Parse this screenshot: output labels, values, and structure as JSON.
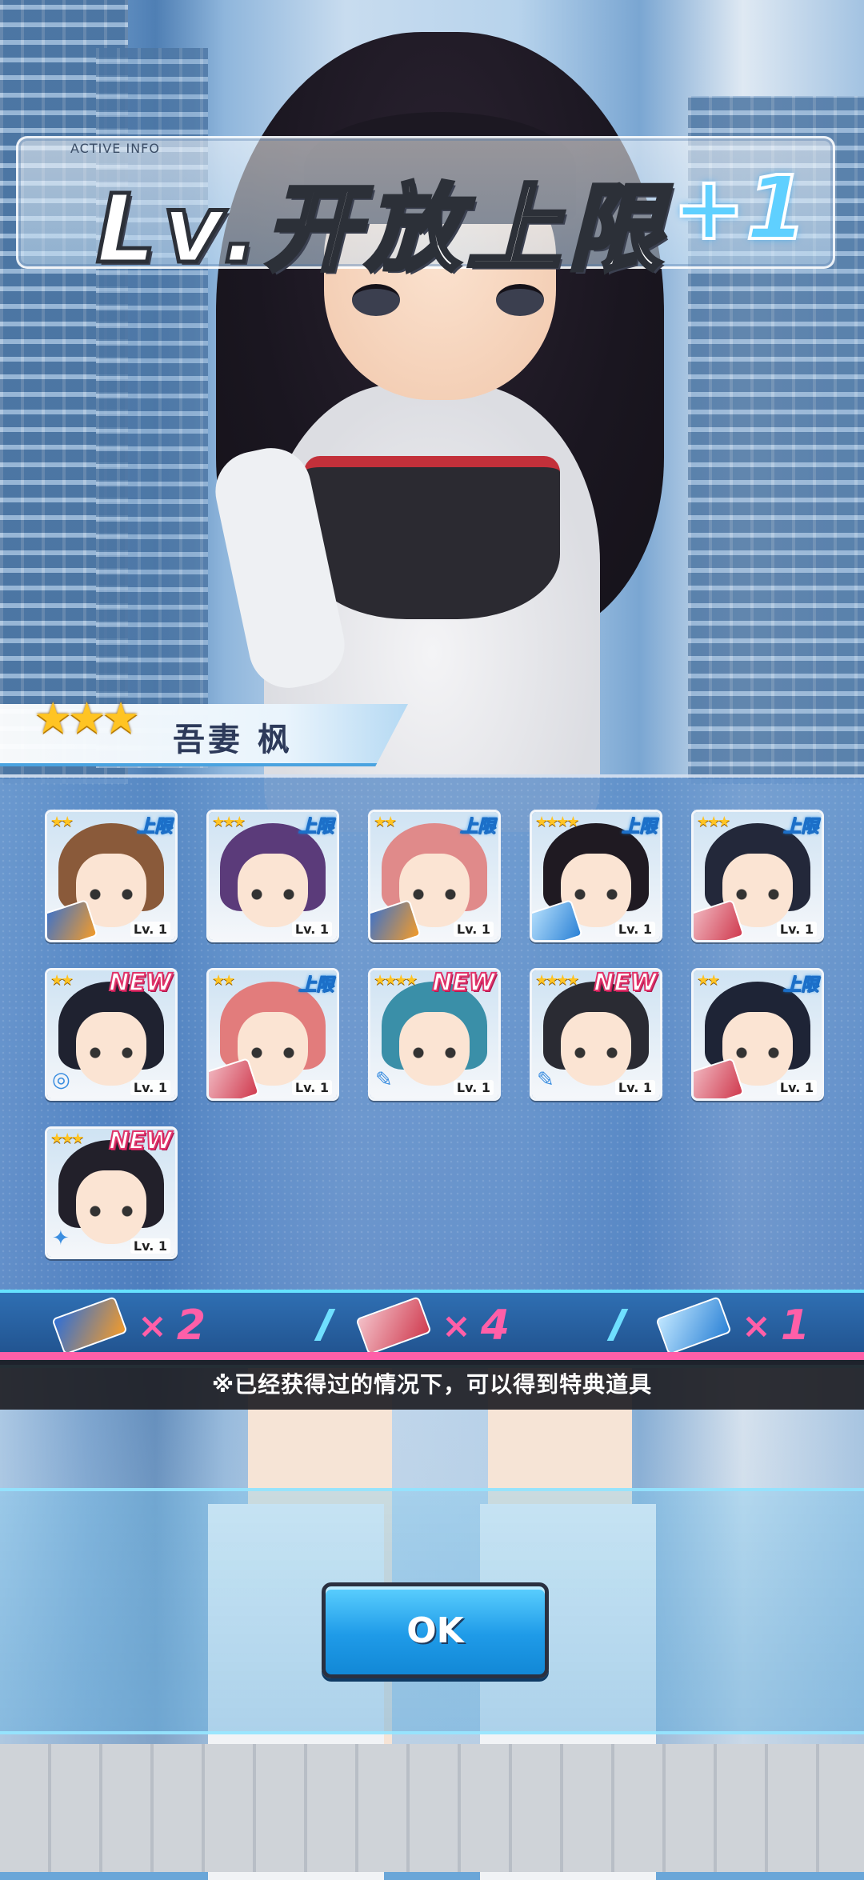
{
  "banner": {
    "tag": "ACTIVE INFO",
    "title": "Lv.开放上限",
    "plus": "+1"
  },
  "character": {
    "rarity_stars": "★★★",
    "name": "吾妻 枫"
  },
  "cards": [
    {
      "stars": "★★",
      "badge": "上限",
      "badge_type": "up",
      "lv": "Lv. 1",
      "hair": "#8a5a3a",
      "item": "book"
    },
    {
      "stars": "★★★",
      "badge": "上限",
      "badge_type": "up",
      "lv": "Lv. 1",
      "hair": "#5b3b7a",
      "item": ""
    },
    {
      "stars": "★★",
      "badge": "上限",
      "badge_type": "up",
      "lv": "Lv. 1",
      "hair": "#e08a8a",
      "item": "book"
    },
    {
      "stars": "★★★★",
      "badge": "上限",
      "badge_type": "up",
      "lv": "Lv. 1",
      "hair": "#1f1a22",
      "item": "blue"
    },
    {
      "stars": "★★★",
      "badge": "上限",
      "badge_type": "up",
      "lv": "Lv. 1",
      "hair": "#23283a",
      "item": "ticket"
    },
    {
      "stars": "★★",
      "badge": "NEW",
      "badge_type": "new",
      "lv": "Lv. 1",
      "hair": "#1f2230",
      "item": "",
      "mini": "◎"
    },
    {
      "stars": "★★",
      "badge": "上限",
      "badge_type": "up",
      "lv": "Lv. 1",
      "hair": "#e27c7c",
      "item": "ticket"
    },
    {
      "stars": "★★★★",
      "badge": "NEW",
      "badge_type": "new",
      "lv": "Lv. 1",
      "hair": "#3a8fa8",
      "item": "",
      "mini": "✎"
    },
    {
      "stars": "★★★★",
      "badge": "NEW",
      "badge_type": "new",
      "lv": "Lv. 1",
      "hair": "#2a2b33",
      "item": "",
      "mini": "✎"
    },
    {
      "stars": "★★",
      "badge": "上限",
      "badge_type": "up",
      "lv": "Lv. 1",
      "hair": "#1e2436",
      "item": "ticket"
    },
    {
      "stars": "★★★",
      "badge": "NEW",
      "badge_type": "new",
      "lv": "Lv. 1",
      "hair": "#22202a",
      "item": "",
      "mini": "✦"
    }
  ],
  "rewards": [
    {
      "icon": "book",
      "x": "×",
      "count": "2"
    },
    {
      "icon": "ticket",
      "x": "×",
      "count": "4"
    },
    {
      "icon": "blue",
      "x": "×",
      "count": "1"
    }
  ],
  "note": "※已经获得过的情况下，可以得到特典道具",
  "ok_button": "OK",
  "colors": {
    "accent": "#1f9be8",
    "new_badge": "#e0336a",
    "star": "#ffc423",
    "count": "#ff5fa8"
  }
}
